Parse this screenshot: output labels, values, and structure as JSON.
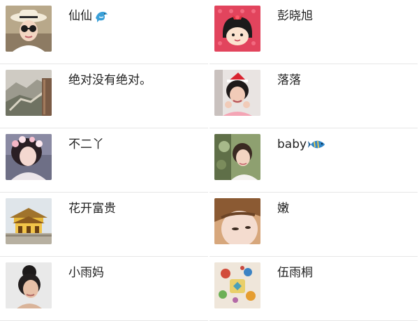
{
  "contacts": [
    {
      "name": "仙仙",
      "emoji": "dolphin-icon",
      "avatar": "woman-sunhat-avatar"
    },
    {
      "name": "彭晓旭",
      "emoji": "",
      "avatar": "cartoon-girl-avatar"
    },
    {
      "name": "绝对没有绝对。",
      "emoji": "",
      "avatar": "great-wall-avatar"
    },
    {
      "name": "落落",
      "emoji": "",
      "avatar": "girl-santa-hat-avatar"
    },
    {
      "name": "不二丫",
      "emoji": "",
      "avatar": "girl-flower-crown-avatar"
    },
    {
      "name": "baby",
      "emoji": "tropical-fish-icon",
      "avatar": "girl-garden-avatar"
    },
    {
      "name": "花开富贵",
      "emoji": "",
      "avatar": "pagoda-building-avatar"
    },
    {
      "name": "嫩",
      "emoji": "",
      "avatar": "closeup-face-avatar"
    },
    {
      "name": "小雨妈",
      "emoji": "",
      "avatar": "woman-bun-avatar"
    },
    {
      "name": "伍雨桐",
      "emoji": "",
      "avatar": "toys-collage-avatar"
    }
  ],
  "colors": {
    "divider": "#e6e6e6",
    "text": "#222222",
    "background": "#ffffff"
  }
}
